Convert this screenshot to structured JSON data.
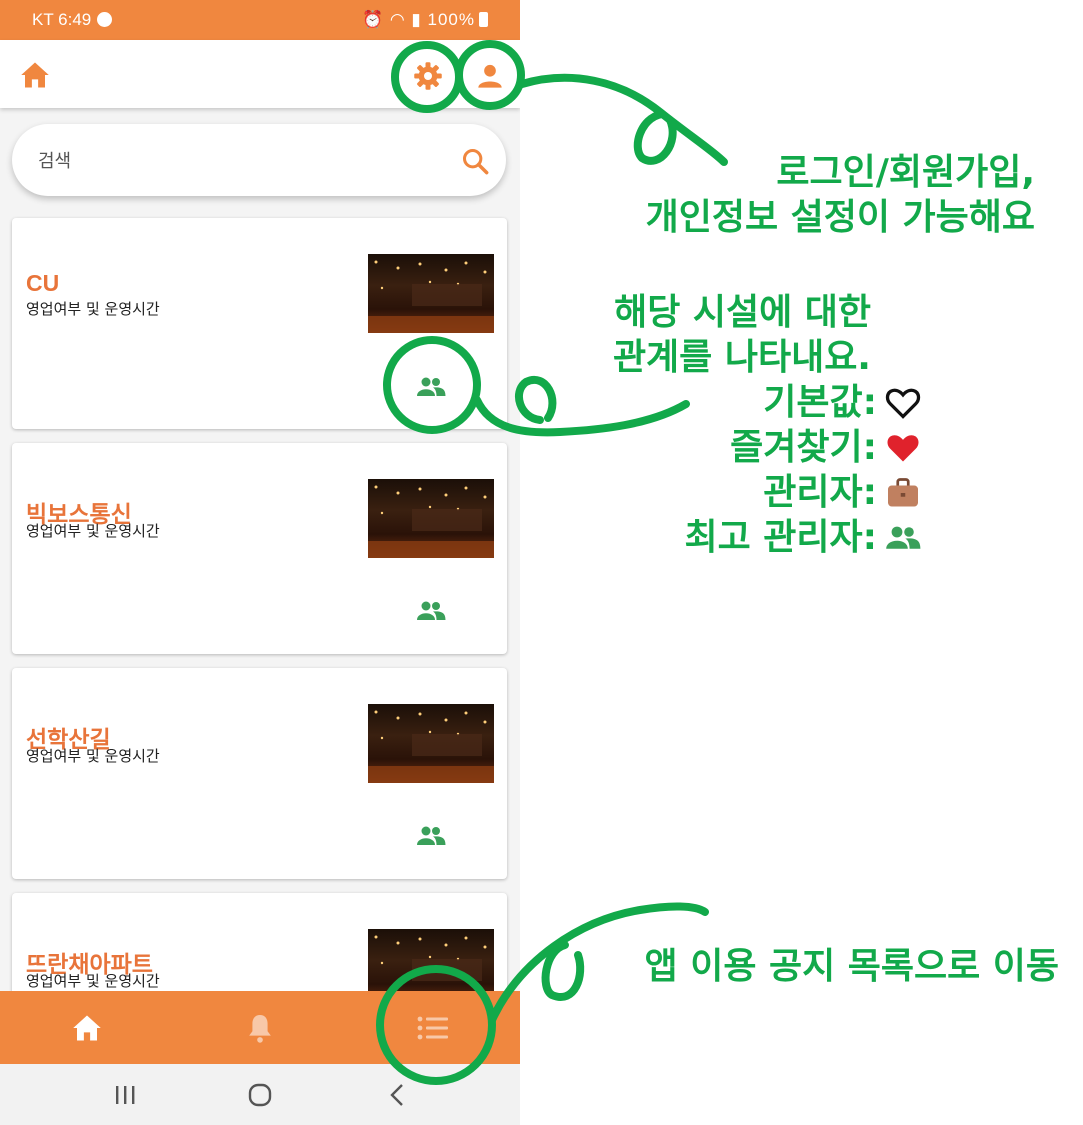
{
  "status_bar": {
    "carrier_time": "KT 6:49",
    "battery": "100%",
    "icons": [
      "message-icon",
      "alarm-icon",
      "wifi-icon",
      "hd-icon",
      "signal-icon",
      "battery-icon"
    ]
  },
  "top_bar": {
    "icons": [
      "home-icon",
      "settings-gear-icon",
      "account-person-icon"
    ]
  },
  "search": {
    "placeholder": "검색",
    "icon": "search-icon"
  },
  "facilities": [
    {
      "name": "CU",
      "status": "영업여부 및 운영시간",
      "relation_icon": "group-people-icon"
    },
    {
      "name": "빅보스통신",
      "status": "영업여부 및 운영시간",
      "relation_icon": "group-people-icon"
    },
    {
      "name": "선학산길",
      "status": "영업여부 및 운영시간",
      "relation_icon": "group-people-icon"
    },
    {
      "name": "뜨란채아파트",
      "status": "영업여부 및 운영시간",
      "relation_icon": "group-people-icon"
    }
  ],
  "bottom_nav": {
    "icons": [
      "home-icon",
      "bell-icon",
      "list-icon"
    ]
  },
  "system_nav": {
    "icons": [
      "recent-apps-icon",
      "home-circle-icon",
      "back-chevron-icon"
    ]
  },
  "colors": {
    "accent": "#f0873f",
    "title": "#e8743a",
    "relation": "#3aa05a",
    "annotation": "#12a94a"
  },
  "annotations": {
    "account_note": {
      "line1": "로그인/회원가입,",
      "line2": "개인정보 설정이 가능해요"
    },
    "relation_note": {
      "line1": "해당 시설에 대한",
      "line2": "관계를 나타내요.",
      "legend": [
        {
          "label": "기본값:",
          "icon": "heart-outline-icon"
        },
        {
          "label": "즐겨찾기:",
          "icon": "heart-red-icon"
        },
        {
          "label": "관리자:",
          "icon": "briefcase-icon"
        },
        {
          "label": "최고 관리자:",
          "icon": "group-people-icon"
        }
      ]
    },
    "notice_note": {
      "text": "앱 이용 공지 목록으로 이동"
    }
  }
}
